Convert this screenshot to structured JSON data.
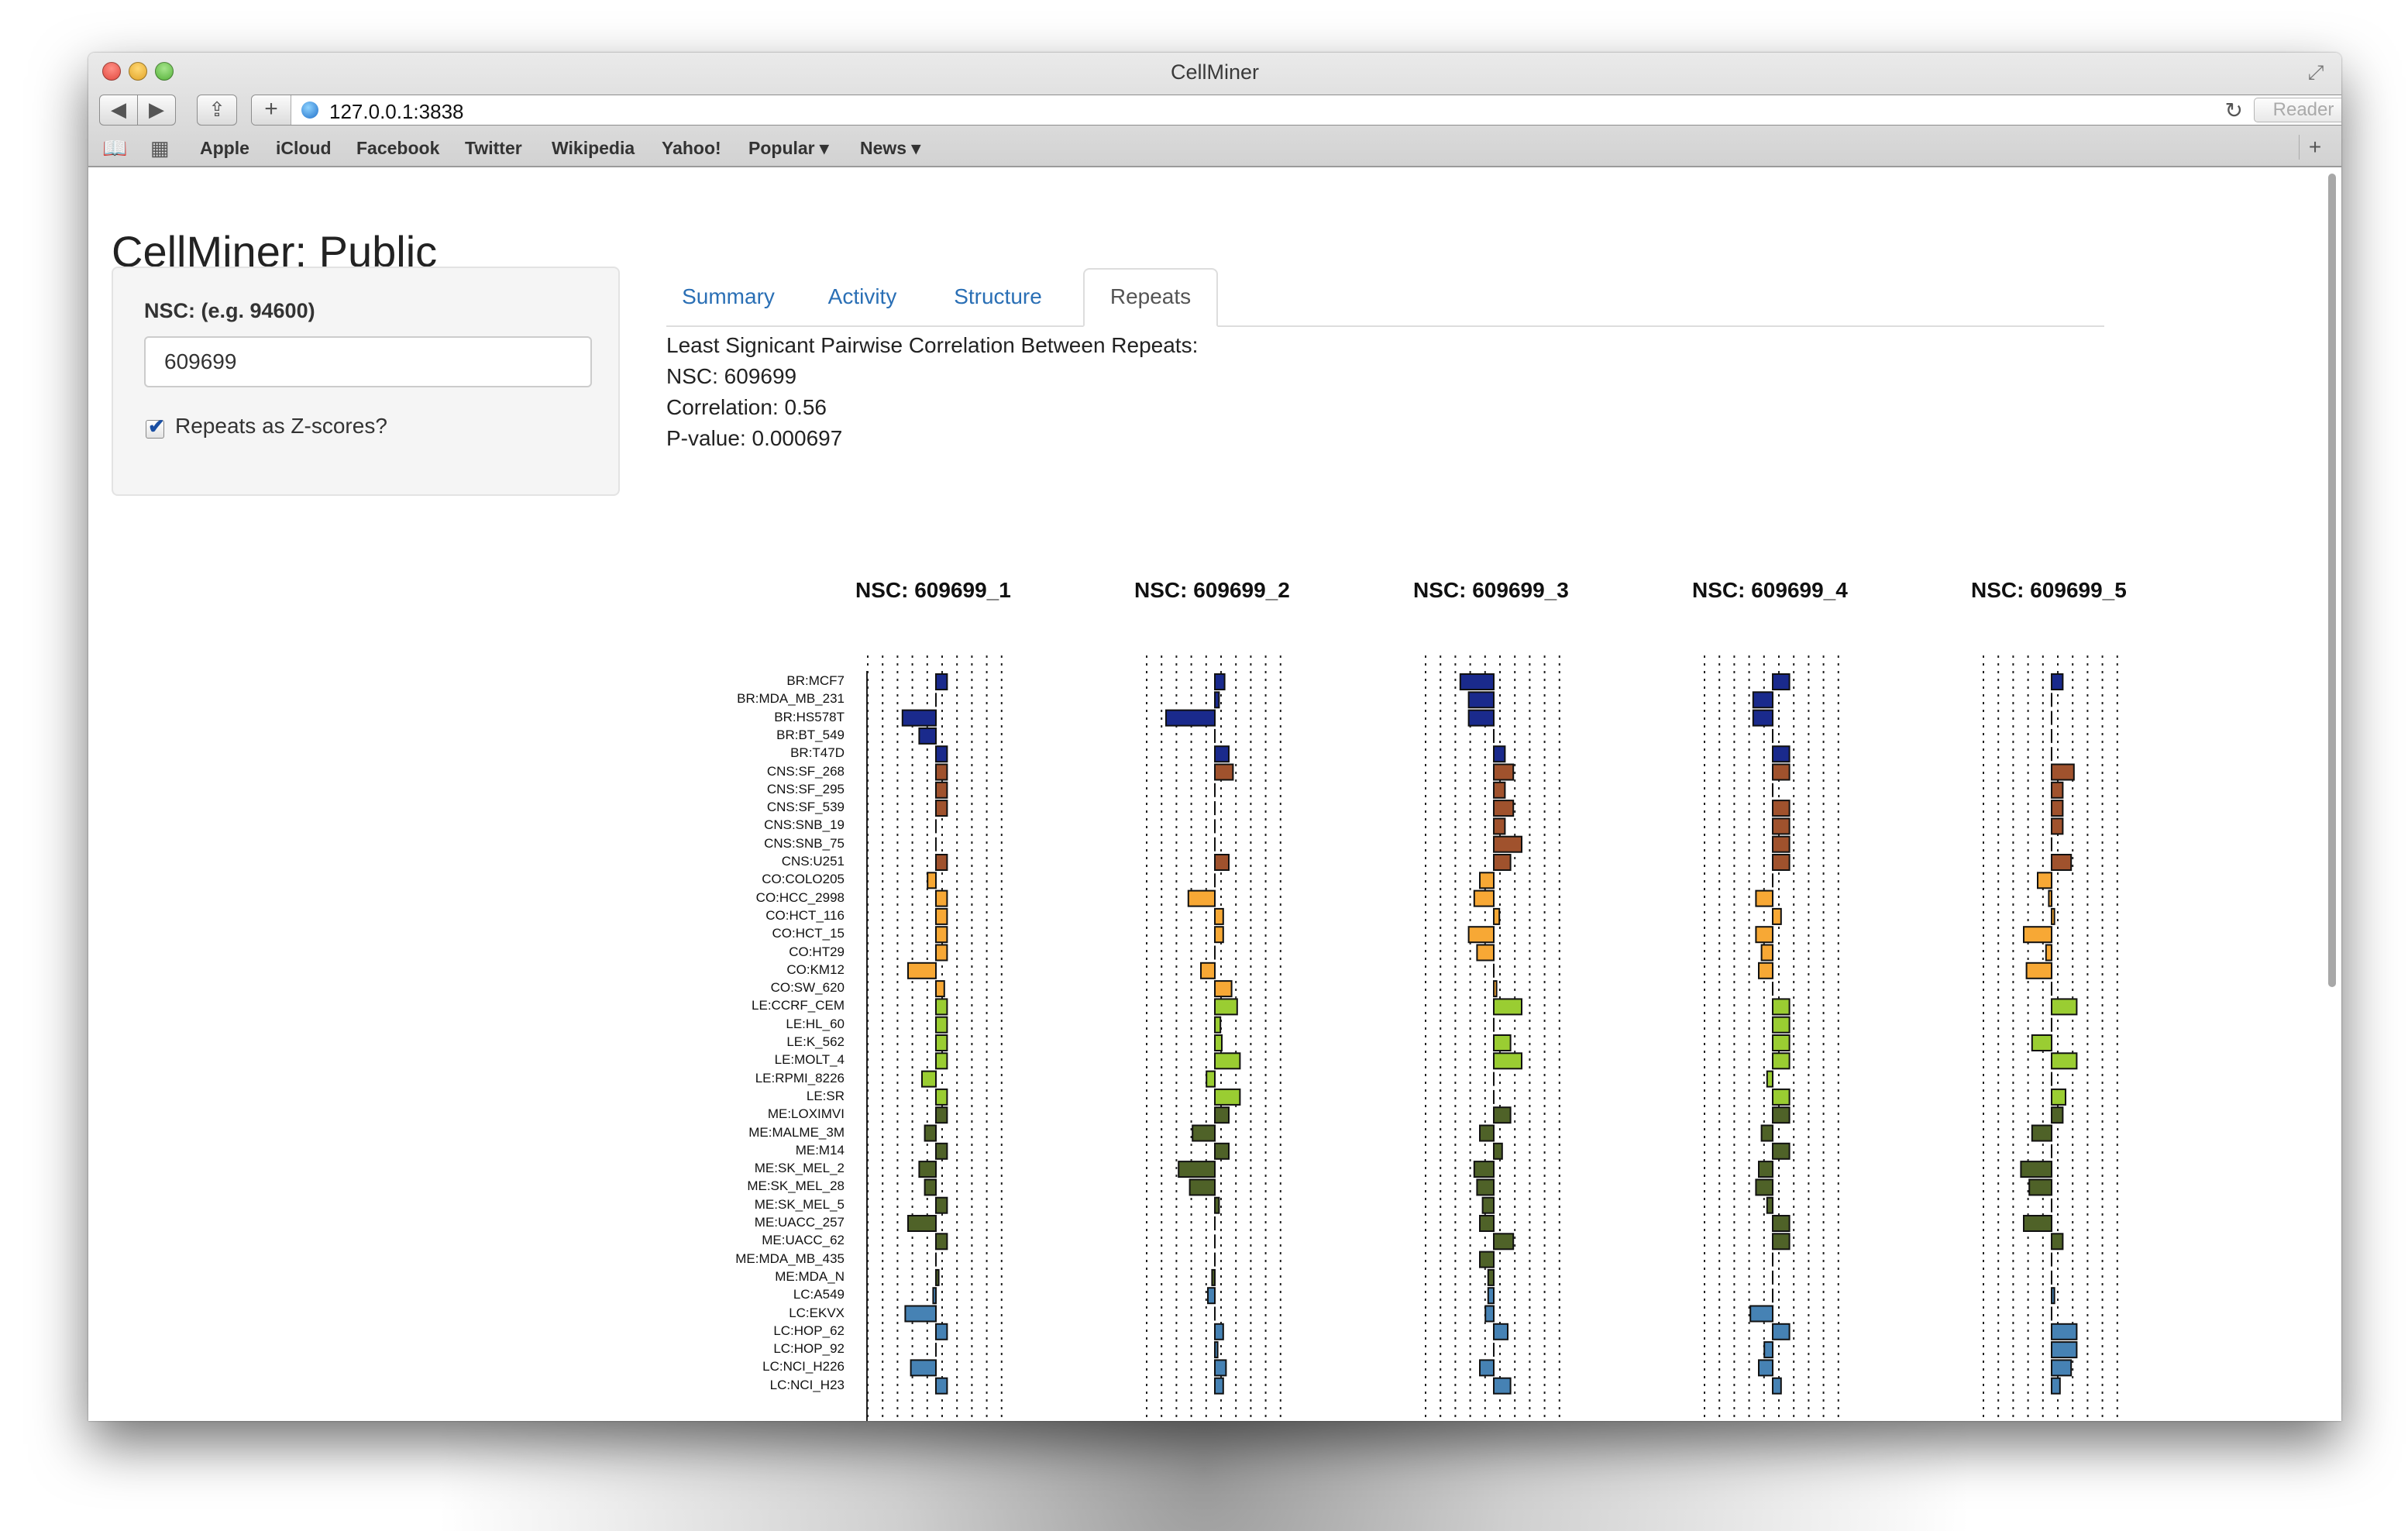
{
  "window": {
    "title": "CellMiner"
  },
  "browser": {
    "url": "127.0.0.1:3838",
    "reader_label": "Reader",
    "bookmarks": [
      "Apple",
      "iCloud",
      "Facebook",
      "Twitter",
      "Wikipedia",
      "Yahoo!",
      "Popular ▾",
      "News ▾"
    ]
  },
  "page": {
    "title": "CellMiner: Public",
    "sidebar": {
      "nsc_label": "NSC: (e.g. 94600)",
      "nsc_value": "609699",
      "checkbox_label": "Repeats as Z-scores?",
      "checkbox_checked": true
    },
    "tabs": [
      {
        "label": "Summary",
        "active": false
      },
      {
        "label": "Activity",
        "active": false
      },
      {
        "label": "Structure",
        "active": false
      },
      {
        "label": "Repeats",
        "active": true
      }
    ],
    "info": {
      "line1": "Least Signicant Pairwise Correlation Between Repeats:",
      "line2": "NSC: 609699",
      "line3": "Correlation: 0.56",
      "line4": "P-value: 0.000697"
    }
  },
  "colors": {
    "BR": "#1a2a8c",
    "CNS": "#a0522d",
    "CO": "#f7a835",
    "LE": "#9acd32",
    "ME": "#4f6228",
    "LC": "#4682b4"
  },
  "chart_data": {
    "type": "bar",
    "orientation": "horizontal",
    "x_scale": "z-score",
    "cell_lines": [
      "BR:MCF7",
      "BR:MDA_MB_231",
      "BR:HS578T",
      "BR:BT_549",
      "BR:T47D",
      "CNS:SF_268",
      "CNS:SF_295",
      "CNS:SF_539",
      "CNS:SNB_19",
      "CNS:SNB_75",
      "CNS:U251",
      "CO:COLO205",
      "CO:HCC_2998",
      "CO:HCT_116",
      "CO:HCT_15",
      "CO:HT29",
      "CO:KM12",
      "CO:SW_620",
      "LE:CCRF_CEM",
      "LE:HL_60",
      "LE:K_562",
      "LE:MOLT_4",
      "LE:RPMI_8226",
      "LE:SR",
      "ME:LOXIMVI",
      "ME:MALME_3M",
      "ME:M14",
      "ME:SK_MEL_2",
      "ME:SK_MEL_28",
      "ME:SK_MEL_5",
      "ME:UACC_257",
      "ME:UACC_62",
      "ME:MDA_MB_435",
      "ME:MDA_N",
      "LC:A549",
      "LC:EKVX",
      "LC:HOP_62",
      "LC:HOP_92",
      "LC:NCI_H226",
      "LC:NCI_H23"
    ],
    "series": [
      {
        "name": "NSC: 609699_1",
        "values": [
          0.8,
          0.0,
          -2.4,
          -1.2,
          0.8,
          0.8,
          0.8,
          0.8,
          0.0,
          0.0,
          0.8,
          -0.6,
          0.8,
          0.8,
          0.8,
          0.8,
          -2.0,
          0.6,
          0.8,
          0.8,
          0.8,
          0.8,
          -1.0,
          0.8,
          0.8,
          -0.8,
          0.8,
          -1.2,
          -0.8,
          0.8,
          -2.0,
          0.8,
          0.0,
          0.2,
          -0.2,
          -2.2,
          0.8,
          0.0,
          -1.8,
          0.8
        ]
      },
      {
        "name": "NSC: 609699_2",
        "values": [
          0.7,
          0.3,
          -3.5,
          0.0,
          1.0,
          1.3,
          0.0,
          0.0,
          0.0,
          0.0,
          1.0,
          0.0,
          -1.9,
          0.6,
          0.6,
          0.0,
          -1.0,
          1.2,
          1.6,
          0.4,
          0.5,
          1.8,
          -0.6,
          1.8,
          1.0,
          -1.6,
          1.0,
          -2.6,
          -1.8,
          0.3,
          0.0,
          0.0,
          0.0,
          -0.2,
          -0.5,
          0.0,
          0.6,
          0.2,
          0.8,
          0.6
        ]
      },
      {
        "name": "NSC: 609699_3",
        "values": [
          -2.4,
          -1.8,
          -1.8,
          0.0,
          0.8,
          1.4,
          0.8,
          1.4,
          0.8,
          2.0,
          1.2,
          -1.0,
          -1.4,
          0.4,
          -1.8,
          -1.2,
          0.0,
          0.2,
          2.0,
          0.0,
          1.2,
          2.0,
          0.0,
          0.0,
          1.2,
          -1.0,
          0.6,
          -1.4,
          -1.2,
          -0.8,
          -1.0,
          1.4,
          -1.0,
          -0.4,
          -0.4,
          -0.6,
          1.0,
          0.0,
          -1.0,
          1.2
        ]
      },
      {
        "name": "NSC: 609699_4",
        "values": [
          1.2,
          -1.4,
          -1.4,
          0.0,
          1.2,
          1.2,
          0.0,
          1.2,
          1.2,
          1.2,
          1.2,
          0.0,
          -1.2,
          0.6,
          -1.2,
          -0.8,
          -1.0,
          0.0,
          1.2,
          1.2,
          1.2,
          1.2,
          -0.4,
          1.2,
          1.2,
          -0.8,
          1.2,
          -1.0,
          -1.2,
          -0.4,
          1.2,
          1.2,
          0.0,
          0.0,
          0.0,
          -1.6,
          1.2,
          -0.6,
          -1.0,
          0.6
        ]
      },
      {
        "name": "NSC: 609699_5",
        "values": [
          0.8,
          0.0,
          0.0,
          0.0,
          0.0,
          1.6,
          0.8,
          0.8,
          0.8,
          0.0,
          1.4,
          -1.0,
          -0.2,
          0.2,
          -2.0,
          -0.4,
          -1.8,
          0.0,
          1.8,
          0.0,
          -1.4,
          1.8,
          0.0,
          1.0,
          0.8,
          -1.4,
          0.0,
          -2.2,
          -1.6,
          0.0,
          -2.0,
          0.8,
          0.0,
          0.0,
          0.2,
          0.0,
          1.8,
          1.8,
          1.4,
          0.6
        ]
      }
    ]
  }
}
